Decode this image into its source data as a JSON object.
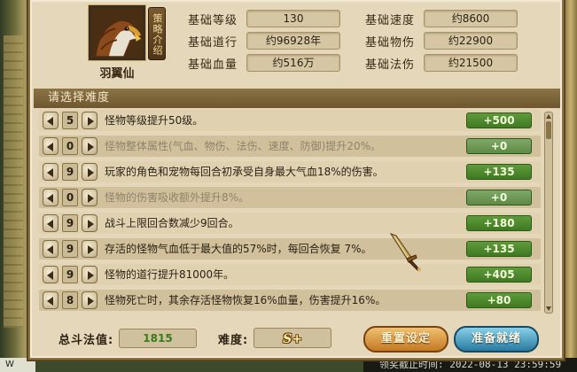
{
  "monster": {
    "name": "羽翼仙",
    "strategy_label": "策略介绍"
  },
  "stats": {
    "level_label": "基础等级",
    "level_value": "130",
    "dao_label": "基础道行",
    "dao_value": "约96928年",
    "hp_label": "基础血量",
    "hp_value": "约516万",
    "speed_label": "基础速度",
    "speed_value": "约8600",
    "phys_label": "基础物伤",
    "phys_value": "约22900",
    "magic_label": "基础法伤",
    "magic_value": "约21500"
  },
  "difficulty": {
    "header": "请选择难度",
    "rows": [
      {
        "level": "5",
        "text": "怪物等级提升50级。",
        "bonus": "+500",
        "active": true
      },
      {
        "level": "0",
        "text": "怪物整体属性(气血、物伤、法伤、速度、防御)提升20%。",
        "bonus": "+0",
        "active": false
      },
      {
        "level": "9",
        "text": "玩家的角色和宠物每回合初承受自身最大气血18%的伤害。",
        "bonus": "+135",
        "active": true
      },
      {
        "level": "0",
        "text": "怪物的伤害吸收额外提升8%。",
        "bonus": "+0",
        "active": false
      },
      {
        "level": "9",
        "text": "战斗上限回合数减少9回合。",
        "bonus": "+180",
        "active": true
      },
      {
        "level": "9",
        "text": "存活的怪物气血低于最大值的57%时，每回合恢复 7%。",
        "bonus": "+135",
        "active": true
      },
      {
        "level": "9",
        "text": "怪物的道行提升81000年。",
        "bonus": "+405",
        "active": true
      },
      {
        "level": "8",
        "text": "怪物死亡时，其余存活怪物恢复16%血量，伤害提升16%。",
        "bonus": "+80",
        "active": true
      }
    ]
  },
  "footer": {
    "total_label": "总斗法值:",
    "total_value": "1815",
    "rank_label": "难度:",
    "rank_value": "S+",
    "reset_label": "重置设定",
    "ready_label": "准备就绪"
  },
  "scene": {
    "bottom_left_text": "W",
    "bottom_strip_text": "领奖截止时间: 2022-08-13 23:59:59"
  },
  "colors": {
    "panel_bg": "#e4d7ba",
    "header_bar": "#7d6438",
    "bonus_green": "#4e8a2c",
    "reset_orange": "#d98e35",
    "ready_blue": "#3d8fb8"
  }
}
